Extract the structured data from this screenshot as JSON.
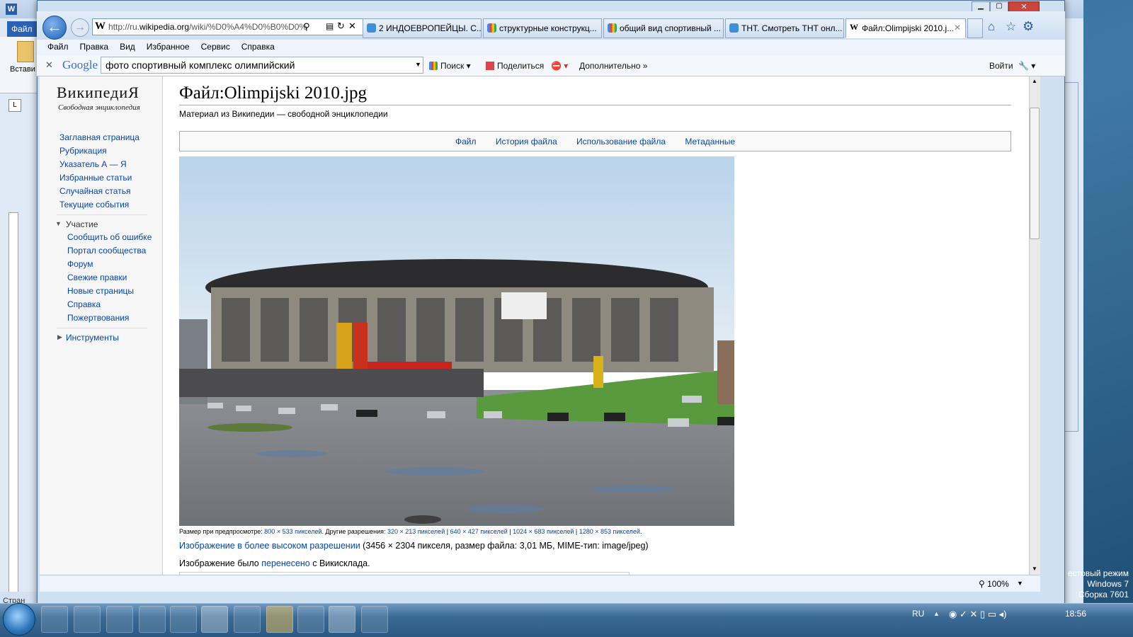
{
  "browser": {
    "address": "http://ru.wikipedia.org/wiki/%D0%A4%D0%B0%D0%",
    "address_prefix": "http://ru.",
    "address_domain": "wikipedia.org",
    "address_rest": "/wiki/%D0%A4%D0%B0%D0%",
    "tabs": [
      {
        "label": "2 ИНДОЕВРОПЕЙЦЫ. С...",
        "icon": "ie-icon"
      },
      {
        "label": "структурные конструкц...",
        "icon": "google-icon"
      },
      {
        "label": "общий вид спортивный ...",
        "icon": "google-icon"
      },
      {
        "label": "ТНТ. Смотреть ТНТ онл...",
        "icon": "ie-icon"
      },
      {
        "label": "Файл:Olimpijski 2010.j...",
        "icon": "wiki-icon"
      }
    ],
    "menu": [
      "Файл",
      "Правка",
      "Вид",
      "Избранное",
      "Сервис",
      "Справка"
    ],
    "google": {
      "logo": "Google",
      "query": "фото спортивный комплекс  олимпийский",
      "search": "Поиск",
      "share": "Поделиться",
      "more": "Дополнительно",
      "signin": "Войти"
    },
    "zoom": "100%"
  },
  "word": {
    "tab": "Файл",
    "paste": "Встави",
    "status": "Стран"
  },
  "wiki": {
    "logo_title": "ВикипедиЯ",
    "logo_sub": "Свободная энциклопедия",
    "nav_main": [
      "Заглавная страница",
      "Рубрикация",
      "Указатель А — Я",
      "Избранные статьи",
      "Случайная статья",
      "Текущие события"
    ],
    "participation_header": "Участие",
    "nav_participation": [
      "Сообщить об ошибке",
      "Портал сообщества",
      "Форум",
      "Свежие правки",
      "Новые страницы",
      "Справка",
      "Пожертвования"
    ],
    "tools_header": "Инструменты",
    "title": "Файл:Olimpijski 2010.jpg",
    "subtitle": "Материал из Википедии — свободной энциклопедии",
    "file_tabs": [
      "Файл",
      "История файла",
      "Использование файла",
      "Метаданные"
    ],
    "preview_prefix": "Размер при предпросмотре: ",
    "preview_size": "800 × 533 пикселей",
    "other_prefix": ". Другие разрешения: ",
    "other_res": [
      "320 × 213 пикселей",
      "640 × 427 пикселей",
      "1024 × 683 пикселей",
      "1280 × 853 пикселей"
    ],
    "hires_link": "Изображение в более высоком разрешении",
    "hires_info": " (3456 × 2304 пикселя, размер файла: 3,01 МБ, MIME-тип: image/jpeg)",
    "moved_prefix": "Изображение было ",
    "moved_link": "перенесено",
    "moved_suffix": " с Викисклада."
  },
  "desktop": {
    "watermark": [
      "естовый режим",
      "Windows 7",
      "Сборка 7601"
    ],
    "lang": "RU",
    "clock": "18:56"
  }
}
